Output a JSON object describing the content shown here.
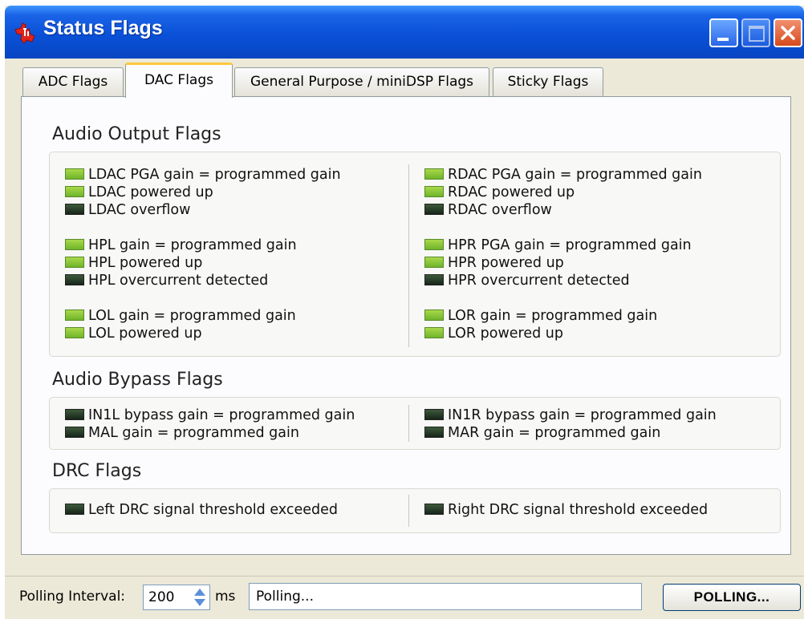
{
  "window": {
    "title": "Status Flags",
    "app_icon": "texas-instruments-logo-icon",
    "controls": [
      "minimize-icon",
      "maximize-icon",
      "close-icon"
    ],
    "colors": {
      "titlebar": "#0a51d8",
      "led_on": "#8cc63f",
      "led_off": "#1f3322",
      "active_tab_accent": "#ffc83c"
    }
  },
  "tabs": [
    {
      "label": "ADC Flags",
      "active": false
    },
    {
      "label": "DAC Flags",
      "active": true
    },
    {
      "label": "General Purpose / miniDSP Flags",
      "active": false
    },
    {
      "label": "Sticky Flags",
      "active": false
    }
  ],
  "sections": {
    "audio_output": {
      "title": "Audio Output Flags",
      "left": [
        {
          "label": "LDAC PGA gain = programmed gain",
          "on": true
        },
        {
          "label": "LDAC powered up",
          "on": true
        },
        {
          "label": "LDAC overflow",
          "on": false
        },
        {
          "label": "HPL gain = programmed gain",
          "on": true
        },
        {
          "label": "HPL powered up",
          "on": true
        },
        {
          "label": "HPL overcurrent detected",
          "on": false
        },
        {
          "label": "LOL gain = programmed gain",
          "on": true
        },
        {
          "label": "LOL powered up",
          "on": true
        }
      ],
      "right": [
        {
          "label": "RDAC PGA gain = programmed gain",
          "on": true
        },
        {
          "label": "RDAC powered up",
          "on": true
        },
        {
          "label": "RDAC overflow",
          "on": false
        },
        {
          "label": "HPR PGA gain = programmed gain",
          "on": true
        },
        {
          "label": "HPR powered up",
          "on": true
        },
        {
          "label": "HPR overcurrent detected",
          "on": false
        },
        {
          "label": "LOR gain = programmed gain",
          "on": true
        },
        {
          "label": "LOR powered up",
          "on": true
        }
      ]
    },
    "audio_bypass": {
      "title": "Audio Bypass Flags",
      "left": [
        {
          "label": "IN1L bypass gain = programmed gain",
          "on": false
        },
        {
          "label": "MAL gain = programmed gain",
          "on": false
        }
      ],
      "right": [
        {
          "label": "IN1R bypass gain = programmed gain",
          "on": false
        },
        {
          "label": "MAR gain = programmed gain",
          "on": false
        }
      ]
    },
    "drc": {
      "title": "DRC Flags",
      "left": [
        {
          "label": "Left DRC signal threshold exceeded",
          "on": false
        }
      ],
      "right": [
        {
          "label": "Right DRC signal threshold exceeded",
          "on": false
        }
      ]
    }
  },
  "statusbar": {
    "polling_label": "Polling Interval:",
    "interval_value": "200",
    "interval_unit": "ms",
    "status_text": "Polling...",
    "button_label": "POLLING..."
  }
}
